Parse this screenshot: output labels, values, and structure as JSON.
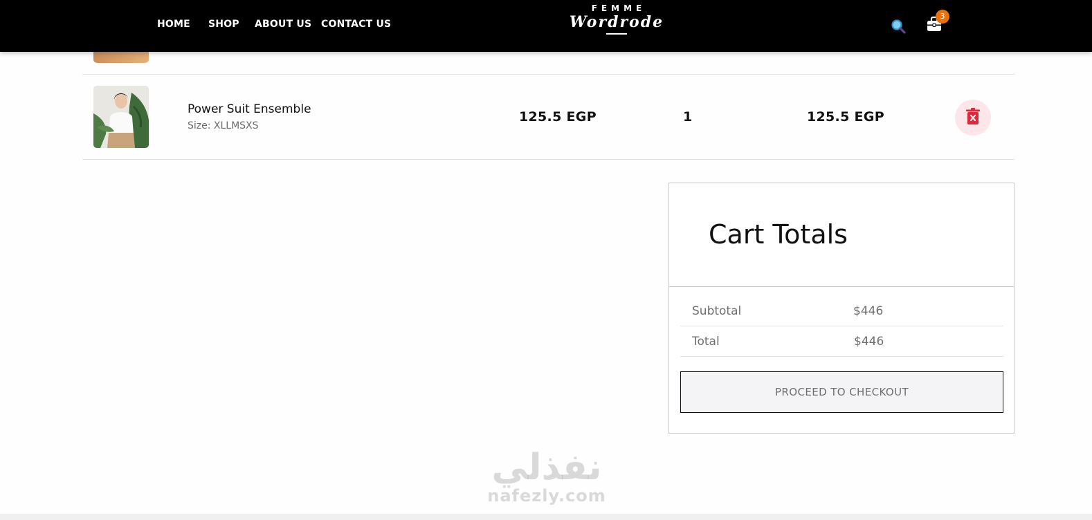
{
  "header": {
    "nav": [
      "HOME",
      "SHOP",
      "ABOUT US",
      "CONTACT US"
    ],
    "logo_top": "FEMME",
    "logo_main": "Wordrode",
    "cart_count": "3",
    "icons": {
      "search": "search-icon",
      "cart": "cart-icon"
    },
    "colors": {
      "bar": "#000000",
      "badge": "#e8720c",
      "search_icon": "#3aa0d8"
    }
  },
  "cart": {
    "items": [
      {
        "name": "Power Suit Ensemble",
        "size": "Size: XLLMSXS",
        "price": "125.5 EGP",
        "quantity": "1",
        "subtotal": "125.5 EGP"
      }
    ],
    "delete_icon": "trash-icon",
    "delete_color": "#d9293a"
  },
  "totals": {
    "title": "Cart Totals",
    "subtotal_label": "Subtotal",
    "subtotal_value": "$446",
    "total_label": "Total",
    "total_value": "$446",
    "checkout_label": "PROCEED TO CHECKOUT"
  },
  "watermark": {
    "arabic": "نفذلي",
    "latin": "nafezly.com"
  }
}
